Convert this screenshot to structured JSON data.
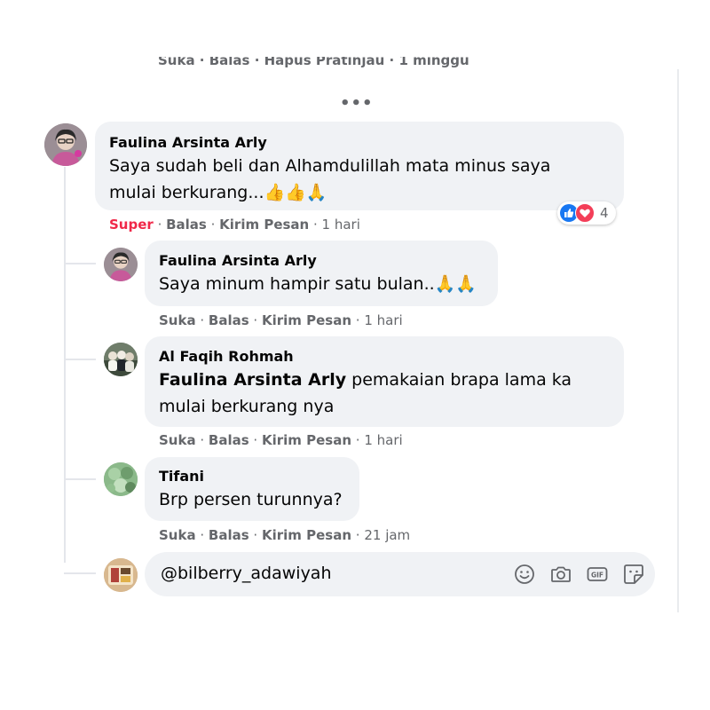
{
  "previous_comment": {
    "actions_text": "Suka · Balas · Hapus Pratinjau · 1 minggu"
  },
  "more_replies_label": "•••",
  "comments": [
    {
      "author": "Faulina Arsinta Arly",
      "text": "Saya sudah beli dan Alhamdulillah mata minus saya mulai berkurang...👍👍🙏",
      "actions": {
        "react": "Super",
        "reply": "Balas",
        "message": "Kirim Pesan",
        "time": "1 hari"
      },
      "reactions": {
        "icons": [
          "like-icon",
          "love-icon"
        ],
        "count": "4"
      }
    }
  ],
  "replies": [
    {
      "author": "Faulina Arsinta Arly",
      "text": "Saya minum hampir satu bulan..🙏🙏",
      "actions": {
        "like": "Suka",
        "reply": "Balas",
        "message": "Kirim Pesan",
        "time": "1 hari"
      }
    },
    {
      "author": "Al Faqih Rohmah",
      "mention": "Faulina Arsinta Arly",
      "text": "pemakaian brapa lama ka",
      "text2": "mulai berkurang nya",
      "actions": {
        "like": "Suka",
        "reply": "Balas",
        "message": "Kirim Pesan",
        "time": "1 hari"
      }
    },
    {
      "author": "Tifani",
      "text": "Brp persen turunnya?",
      "actions": {
        "like": "Suka",
        "reply": "Balas",
        "message": "Kirim Pesan",
        "time": "21 jam"
      }
    }
  ],
  "reply_input": {
    "value": "@bilberry_adawiyah",
    "icons": [
      "emoji-icon",
      "camera-icon",
      "gif-icon",
      "sticker-icon"
    ]
  },
  "colors": {
    "bubble": "#f0f2f5",
    "link_gray": "#65676b",
    "super_red": "#f02849",
    "like_blue": "#1877f2"
  }
}
